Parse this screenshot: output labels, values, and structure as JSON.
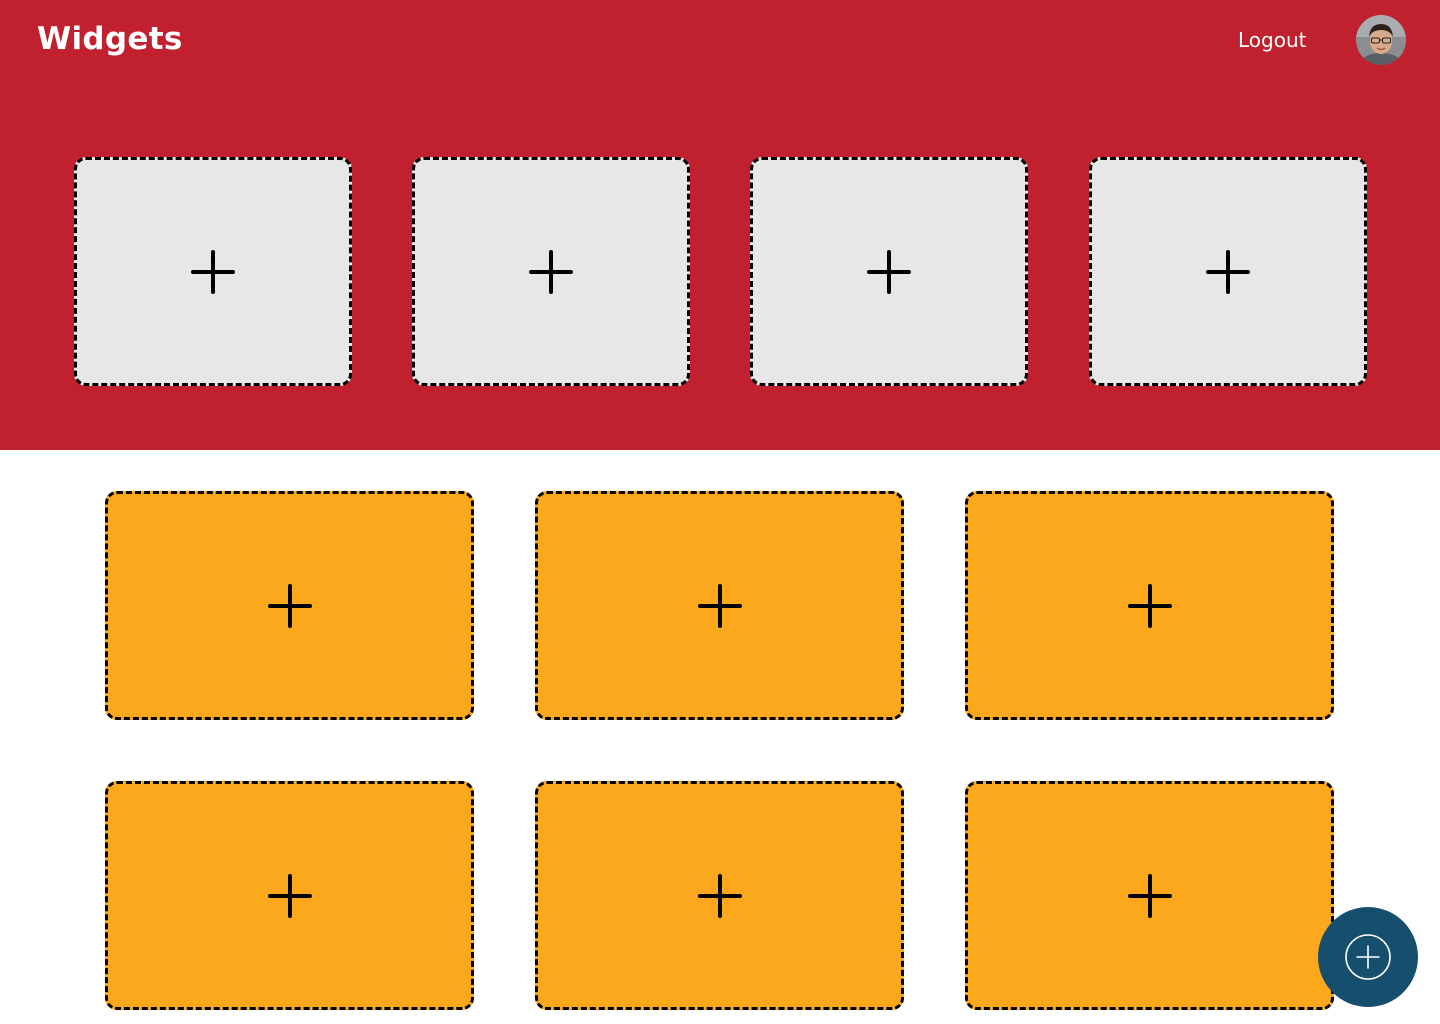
{
  "header": {
    "title": "Widgets",
    "logout_label": "Logout",
    "background": "#c1202e"
  },
  "avatar": {
    "icon": "user-avatar"
  },
  "top_widgets": [
    {
      "icon": "plus-icon",
      "state": "empty"
    },
    {
      "icon": "plus-icon",
      "state": "empty"
    },
    {
      "icon": "plus-icon",
      "state": "empty"
    },
    {
      "icon": "plus-icon",
      "state": "empty"
    }
  ],
  "main_widgets": [
    {
      "icon": "plus-icon",
      "state": "empty"
    },
    {
      "icon": "plus-icon",
      "state": "empty"
    },
    {
      "icon": "plus-icon",
      "state": "empty"
    },
    {
      "icon": "plus-icon",
      "state": "empty"
    },
    {
      "icon": "plus-icon",
      "state": "empty"
    },
    {
      "icon": "plus-icon",
      "state": "empty"
    }
  ],
  "fab": {
    "icon": "plus-circle-icon",
    "color": "#164f6e"
  },
  "colors": {
    "top_slot": "#e7e7e7",
    "main_slot": "#fba81c",
    "border": "#000000"
  }
}
